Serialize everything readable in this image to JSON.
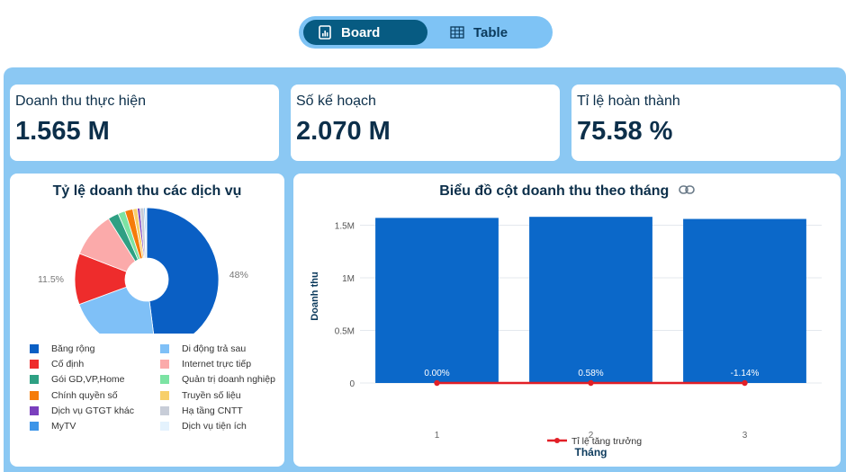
{
  "toggle": {
    "board_label": "Board",
    "table_label": "Table",
    "active": "Board"
  },
  "kpis": [
    {
      "label": "Doanh thu thực hiện",
      "value": "1.565 M"
    },
    {
      "label": "Số kế hoạch",
      "value": "2.070 M"
    },
    {
      "label": "Tỉ lệ hoàn thành",
      "value": "75.58 %"
    }
  ],
  "pie": {
    "title": "Tỷ lệ doanh thu các dịch vụ",
    "chart_data": {
      "type": "pie",
      "title": "Tỷ lệ doanh thu các dịch vụ",
      "slices": [
        {
          "label": "Băng rộng",
          "value": 48,
          "value_label": "48%",
          "color": "#0a5fc4"
        },
        {
          "label": "Di động trả sau",
          "value": 21.4,
          "value_label": "21.4%",
          "color": "#7fc0f7"
        },
        {
          "label": "Cố định",
          "value": 11.5,
          "value_label": "11.5%",
          "color": "#ee2c2c"
        },
        {
          "label": "Internet trực tiếp",
          "value": 10.2,
          "value_label": "",
          "color": "#fbaaaa"
        },
        {
          "label": "Gói GD,VP,Home",
          "value": 2.4,
          "value_label": "",
          "color": "#2ea083"
        },
        {
          "label": "Quản trị doanh nghiệp",
          "value": 1.6,
          "value_label": "",
          "color": "#7ce3a3"
        },
        {
          "label": "Chính quyền số",
          "value": 1.8,
          "value_label": "",
          "color": "#f57c0a"
        },
        {
          "label": "Truyền số liệu",
          "value": 1.0,
          "value_label": "",
          "color": "#f7cf6a"
        },
        {
          "label": "Dịch vụ GTGT khác",
          "value": 0.6,
          "value_label": "",
          "color": "#7a3fbd"
        },
        {
          "label": "Hạ tầng CNTT",
          "value": 0.9,
          "value_label": "",
          "color": "#c8cdd8"
        },
        {
          "label": "MyTV",
          "value": 0.3,
          "value_label": "",
          "color": "#3d95e8"
        },
        {
          "label": "Dịch vụ tiện ích",
          "value": 0.3,
          "value_label": "",
          "color": "#e4f2fd"
        }
      ],
      "hole": true
    },
    "legend": [
      {
        "label": "Băng rộng",
        "color": "#0a5fc4"
      },
      {
        "label": "Di động trả sau",
        "color": "#7fc0f7"
      },
      {
        "label": "Cố định",
        "color": "#ee2c2c"
      },
      {
        "label": "Internet trực tiếp",
        "color": "#fbaaaa"
      },
      {
        "label": "Gói GD,VP,Home",
        "color": "#2ea083"
      },
      {
        "label": "Quản trị doanh nghiệp",
        "color": "#7ce3a3"
      },
      {
        "label": "Chính quyền số",
        "color": "#f57c0a"
      },
      {
        "label": "Truyền số liệu",
        "color": "#f7cf6a"
      },
      {
        "label": "Dịch vụ GTGT khác",
        "color": "#7a3fbd"
      },
      {
        "label": "Hạ tầng CNTT",
        "color": "#c8cdd8"
      },
      {
        "label": "MyTV",
        "color": "#3d95e8"
      },
      {
        "label": "Dịch vụ tiện ích",
        "color": "#e4f2fd"
      }
    ]
  },
  "bar": {
    "title": "Biểu đồ cột doanh thu theo tháng",
    "link_icon": "link-icon",
    "chart_data": {
      "type": "bar",
      "title": "Biểu đồ cột doanh thu theo tháng",
      "categories": [
        "1",
        "2",
        "3"
      ],
      "series": [
        {
          "name": "Doanh thu",
          "type": "bar",
          "values": [
            1570000,
            1580000,
            1560000
          ],
          "color": "#0b68c9"
        },
        {
          "name": "Tỉ lệ tăng trưởng",
          "type": "line",
          "values": [
            0.0,
            0.58,
            -1.14
          ],
          "labels": [
            "0.00%",
            "0.58%",
            "-1.14%"
          ],
          "color": "#e21f26"
        }
      ],
      "xlabel": "Tháng",
      "ylabel": "Doanh thu",
      "ylim": [
        0,
        1650000
      ],
      "yticks": [
        {
          "value": 0,
          "label": "0"
        },
        {
          "value": 500000,
          "label": "0.5M"
        },
        {
          "value": 1000000,
          "label": "1M"
        },
        {
          "value": 1500000,
          "label": "1.5M"
        }
      ],
      "grid": true,
      "legend_placement": "bottom"
    }
  }
}
